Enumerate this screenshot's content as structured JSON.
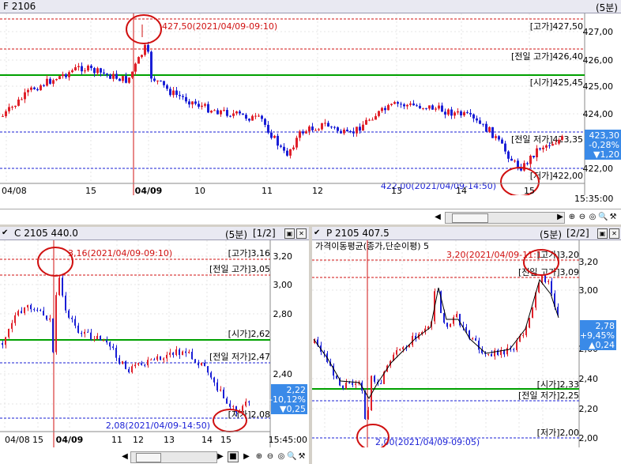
{
  "top": {
    "title": "F 2106",
    "period": "(5분)",
    "x_ticks": [
      "04/08",
      "15",
      "04/09",
      "10",
      "11",
      "12",
      "13",
      "14",
      "15"
    ],
    "y_ticks": [
      "427,00",
      "426,00",
      "425,00",
      "424,00",
      "422,00"
    ],
    "time_end": "15:35:00",
    "levels": {
      "high": "[고가]427,50",
      "prev_high": "[전일 고가]426,40",
      "open": "[시가]425,45",
      "prev_low": "[전일 저가]423,35",
      "low": "[저가]422,00"
    },
    "max_note": "427,50(2021/04/09-09:10)",
    "min_note": "422,00(2021/04/09-14:50)",
    "price_badge": {
      "price": "423,30",
      "pct": "-0,28%",
      "chg": "▼1,20"
    }
  },
  "c": {
    "title": "C 2105 440.0",
    "period": "(5분)",
    "page": "[1/2]",
    "x_ticks": [
      "04/08",
      "15",
      "04/09",
      "11",
      "12",
      "13",
      "14",
      "15"
    ],
    "y_ticks": [
      "3,20",
      "3,00",
      "2,80",
      "2,40",
      "2,20"
    ],
    "time_end": "15:45:00",
    "levels": {
      "high": "[고가]3,16",
      "prev_high": "[전일 고가]3,05",
      "open": "[시가]2,62",
      "prev_low": "[전일 저가]2,47",
      "low": "[저가]2,08"
    },
    "max_note": "3,16(2021/04/09-09:10)",
    "min_note": "2,08(2021/04/09-14:50)",
    "price_badge": {
      "price": "2,22",
      "pct": "-10,12%",
      "chg": "▼0,25"
    }
  },
  "p": {
    "title": "P 2105 407.5",
    "period": "(5분)",
    "page": "[2/2]",
    "indicator": "가격이동평균(종가,단순이평) 5",
    "x_ticks": [
      "04/08",
      "15",
      "04/09",
      "10",
      "11",
      "12",
      "13",
      "14",
      "15"
    ],
    "y_ticks": [
      "3,20",
      "3,00",
      "2,60",
      "2,40",
      "2,20",
      "2,00"
    ],
    "time_end": "15:35:00",
    "levels": {
      "high": "[고가]3,20",
      "prev_high": "[전일 고가]3,09",
      "open": "[시가]2,33",
      "prev_low": "[전일 저가]2,25",
      "low": "[저가]2,00"
    },
    "max_note": "3,20(2021/04/09-11:1",
    "min_note": "2,00(2021/04/09-09:05)",
    "price_badge": {
      "price": "2,78",
      "pct": "+9,45%",
      "chg": "▲0,24"
    }
  },
  "colors": {
    "up": "#e0202a",
    "down": "#1a1fd6",
    "open_line": "#00a000",
    "highlight": "#d01010",
    "badge_bg": "#3a8ae8"
  },
  "icons": [
    "play-left-icon",
    "play-right-icon",
    "stop-icon",
    "zoom-in-icon",
    "zoom-out-icon",
    "zoom-reset-icon",
    "settings-icon",
    "restore-icon",
    "close-icon"
  ]
}
